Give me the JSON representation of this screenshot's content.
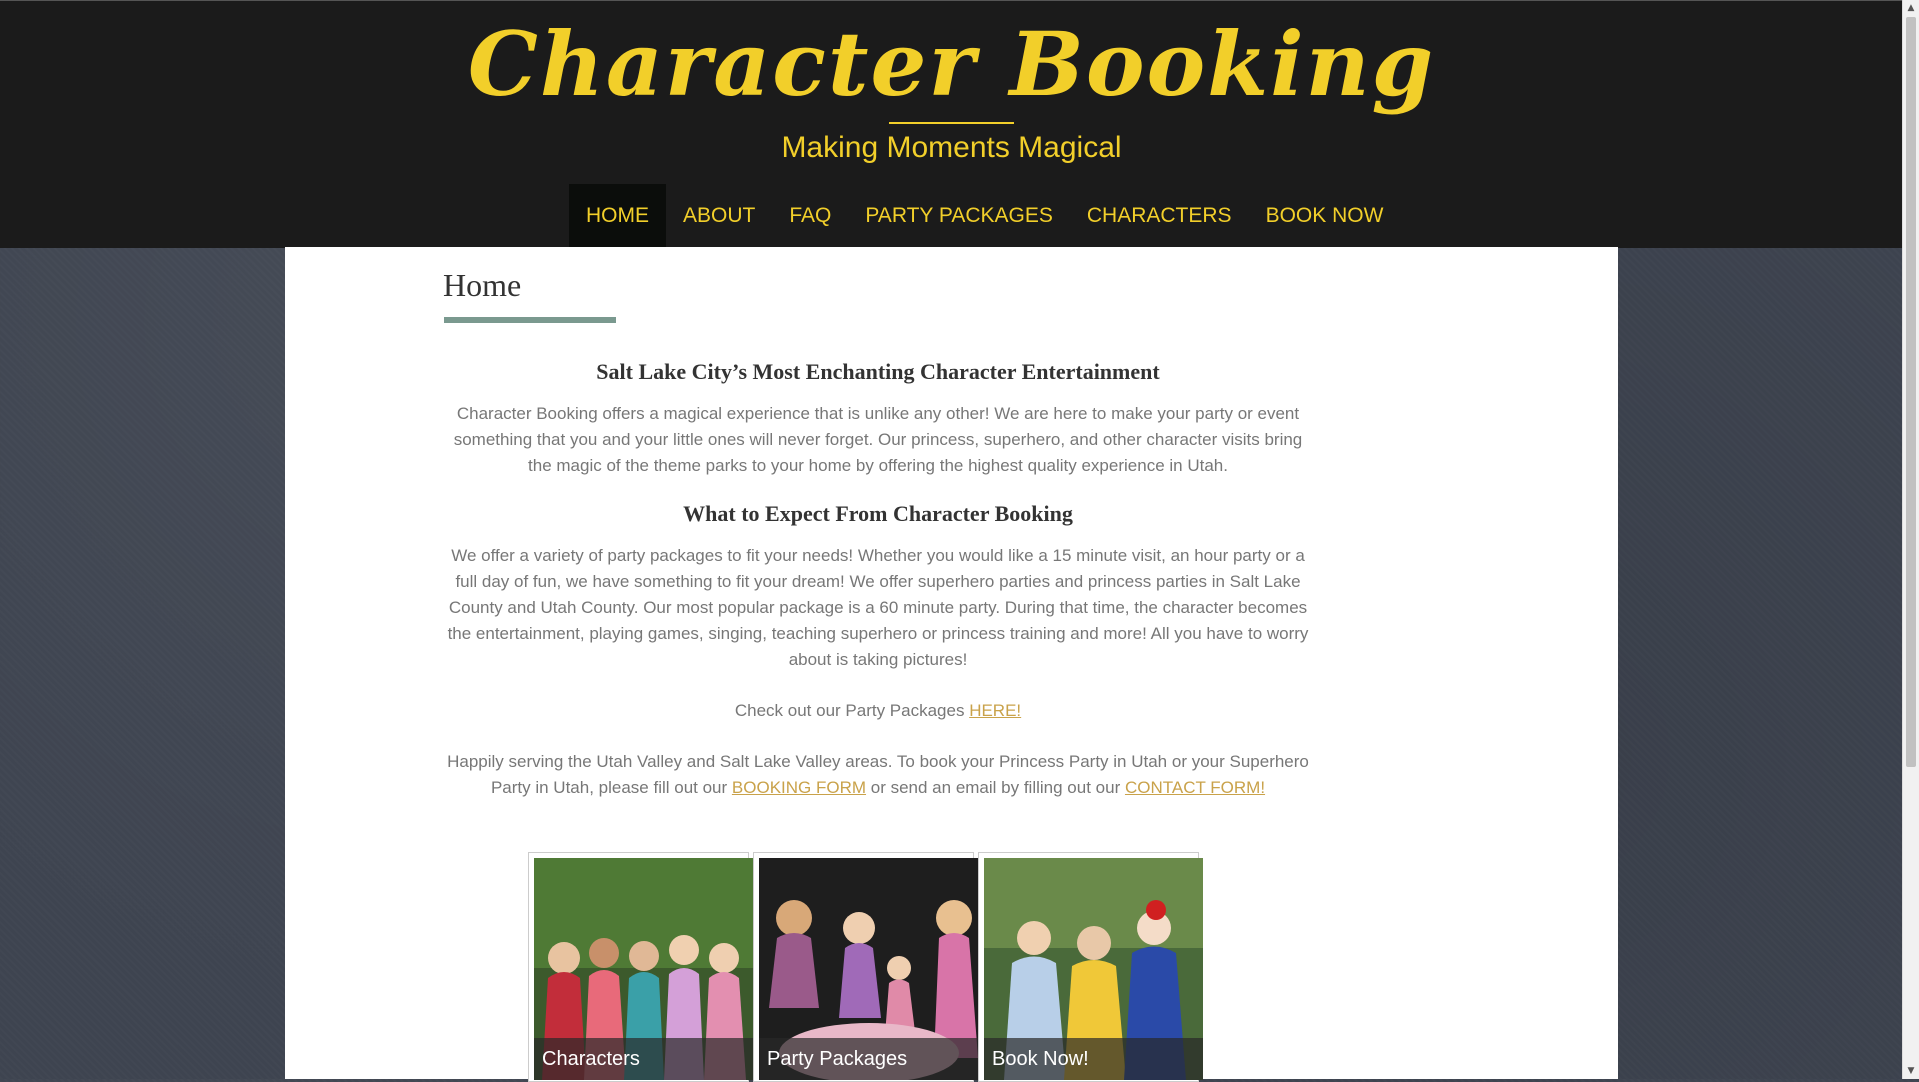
{
  "header": {
    "logo_text": "Character Booking",
    "tagline": "Making Moments Magical"
  },
  "nav": {
    "items": [
      {
        "label": "HOME",
        "active": true
      },
      {
        "label": "ABOUT"
      },
      {
        "label": "FAQ"
      },
      {
        "label": "PARTY PACKAGES"
      },
      {
        "label": "CHARACTERS"
      },
      {
        "label": "BOOK NOW"
      }
    ]
  },
  "main": {
    "title": "Home",
    "heading1": "Salt Lake City’s Most Enchanting Character Entertainment",
    "para1": "Character Booking offers a magical experience that is unlike any other!  We are here to make your party or event something that you and your little ones will never forget. Our princess, superhero, and other character visits bring the magic of the theme parks to your home by offering the highest quality experience in Utah.",
    "heading2": "What to Expect From Character Booking",
    "para2": "We offer a variety of party packages to fit your needs! Whether you would like a 15 minute visit, an hour party or a full day of fun, we have something to fit your dream! We offer superhero parties and princess parties in Salt Lake County and Utah County. Our most popular package is a 60 minute party.  During that time, the character becomes the entertainment, playing games, singing, teaching superhero or princess training and more!  All you have to worry about is taking pictures!",
    "packages_prefix": "Check out our Party Packages ",
    "packages_link": "HERE!",
    "serving_text_1": "Happily serving the Utah Valley and Salt Lake Valley areas. To book your Princess Party in Utah or your Superhero Party in Utah, please fill out our ",
    "booking_link": "BOOKING FORM",
    "serving_text_2": " or send an email by filling out our ",
    "contact_link": "CONTACT FORM!"
  },
  "tiles": [
    {
      "caption": "Characters"
    },
    {
      "caption": "Party Packages"
    },
    {
      "caption": "Book Now!"
    }
  ],
  "colors": {
    "accent_gold": "#f2cf2a",
    "header_bg": "#1b1b1b",
    "link_gold": "#c9a24a",
    "title_rule": "#7a998f"
  }
}
